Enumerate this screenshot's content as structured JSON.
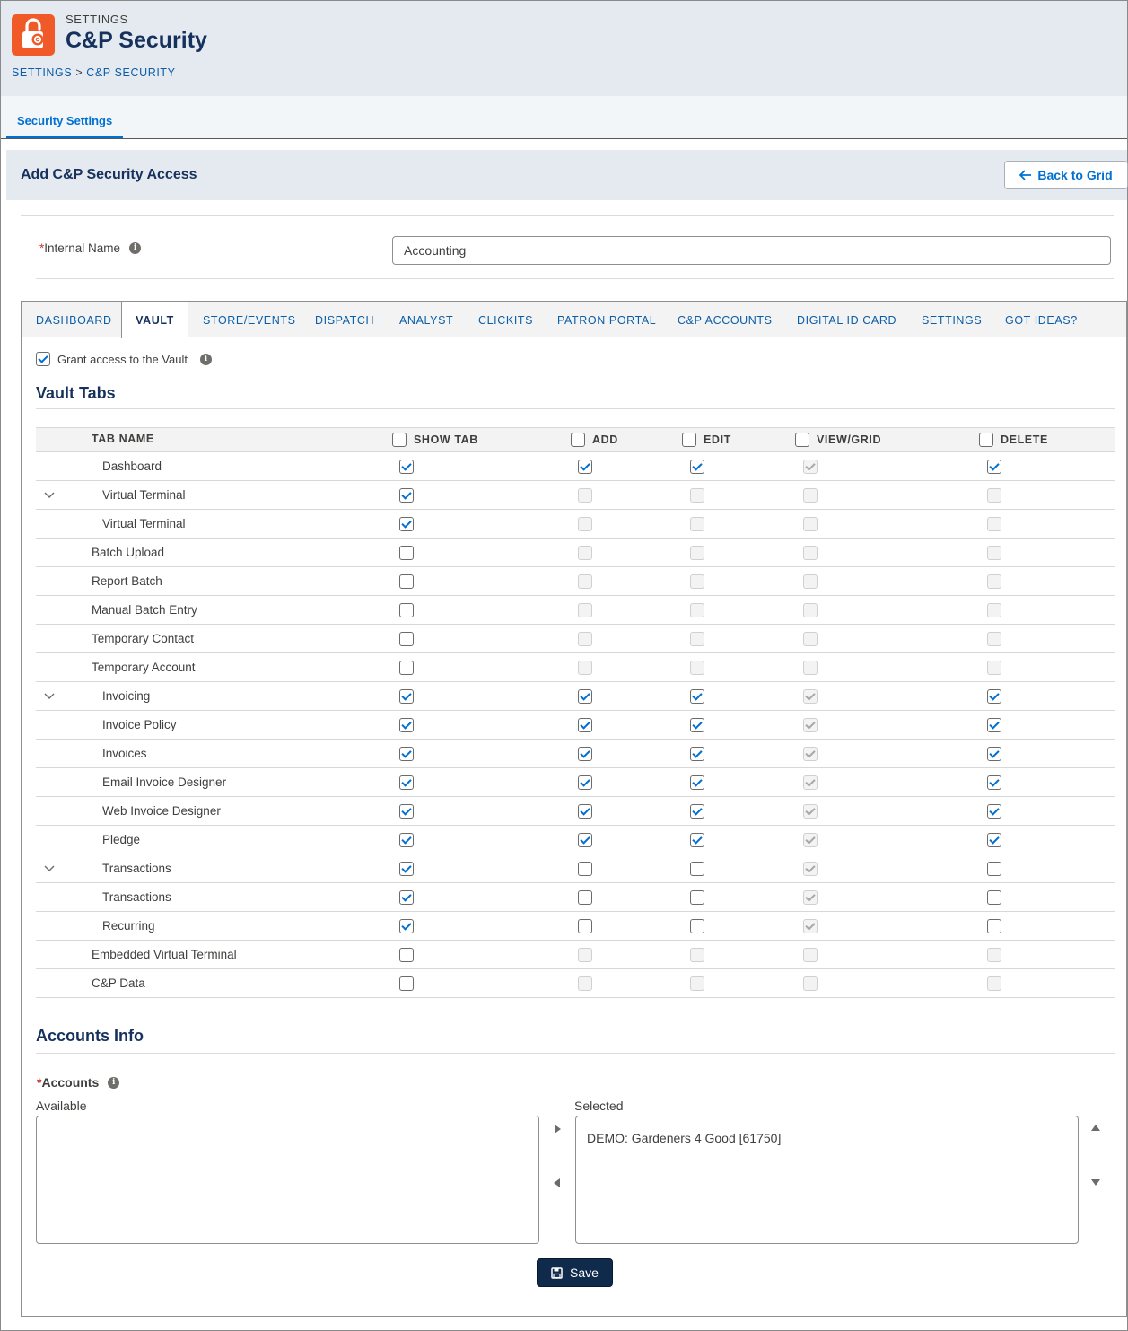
{
  "header": {
    "eyebrow": "SETTINGS",
    "title": "C&P Security",
    "breadcrumb": [
      "SETTINGS",
      ">",
      "C&P SECURITY"
    ]
  },
  "top_tabs": [
    {
      "label": "Security Settings",
      "active": true
    }
  ],
  "section": {
    "title": "Add C&P Security Access",
    "back_button": "Back to Grid"
  },
  "form": {
    "internal_name_label": "Internal Name",
    "internal_name_value": "Accounting"
  },
  "module_tabs": [
    "DASHBOARD",
    "VAULT",
    "STORE/EVENTS",
    "DISPATCH",
    "ANALYST",
    "CLICKITS",
    "PATRON PORTAL",
    "C&P ACCOUNTS",
    "DIGITAL ID CARD",
    "SETTINGS",
    "GOT IDEAS?"
  ],
  "active_module_tab": "VAULT",
  "vault": {
    "grant_label": "Grant access to the Vault",
    "grant_checked": true,
    "tabs_title": "Vault Tabs",
    "columns": [
      "TAB NAME",
      "SHOW TAB",
      "ADD",
      "EDIT",
      "VIEW/GRID",
      "DELETE"
    ],
    "rows": [
      {
        "name": "Dashboard",
        "indent": 1,
        "expander": false,
        "perms": [
          1,
          1,
          1,
          3,
          1
        ]
      },
      {
        "name": "Virtual Terminal",
        "indent": 1,
        "expander": true,
        "perms": [
          1,
          2,
          2,
          2,
          2
        ]
      },
      {
        "name": "Virtual Terminal",
        "indent": 1,
        "expander": false,
        "perms": [
          1,
          2,
          2,
          2,
          2
        ]
      },
      {
        "name": "Batch Upload",
        "indent": 0,
        "expander": false,
        "perms": [
          0,
          2,
          2,
          2,
          2
        ]
      },
      {
        "name": "Report Batch",
        "indent": 0,
        "expander": false,
        "perms": [
          0,
          2,
          2,
          2,
          2
        ]
      },
      {
        "name": "Manual Batch Entry",
        "indent": 0,
        "expander": false,
        "perms": [
          0,
          2,
          2,
          2,
          2
        ]
      },
      {
        "name": "Temporary Contact",
        "indent": 0,
        "expander": false,
        "perms": [
          0,
          2,
          2,
          2,
          2
        ]
      },
      {
        "name": "Temporary Account",
        "indent": 0,
        "expander": false,
        "perms": [
          0,
          2,
          2,
          2,
          2
        ]
      },
      {
        "name": "Invoicing",
        "indent": 1,
        "expander": true,
        "perms": [
          1,
          1,
          1,
          3,
          1
        ]
      },
      {
        "name": "Invoice Policy",
        "indent": 1,
        "expander": false,
        "perms": [
          1,
          1,
          1,
          3,
          1
        ]
      },
      {
        "name": "Invoices",
        "indent": 1,
        "expander": false,
        "perms": [
          1,
          1,
          1,
          3,
          1
        ]
      },
      {
        "name": "Email Invoice Designer",
        "indent": 1,
        "expander": false,
        "perms": [
          1,
          1,
          1,
          3,
          1
        ]
      },
      {
        "name": "Web Invoice Designer",
        "indent": 1,
        "expander": false,
        "perms": [
          1,
          1,
          1,
          3,
          1
        ]
      },
      {
        "name": "Pledge",
        "indent": 1,
        "expander": false,
        "perms": [
          1,
          1,
          1,
          3,
          1
        ]
      },
      {
        "name": "Transactions",
        "indent": 1,
        "expander": true,
        "perms": [
          1,
          0,
          0,
          3,
          0
        ]
      },
      {
        "name": "Transactions",
        "indent": 1,
        "expander": false,
        "perms": [
          1,
          0,
          0,
          3,
          0
        ]
      },
      {
        "name": "Recurring",
        "indent": 1,
        "expander": false,
        "perms": [
          1,
          0,
          0,
          3,
          0
        ]
      },
      {
        "name": "Embedded Virtual Terminal",
        "indent": 0,
        "expander": false,
        "perms": [
          0,
          2,
          2,
          2,
          2
        ]
      },
      {
        "name": "C&P Data",
        "indent": 0,
        "expander": false,
        "perms": [
          0,
          2,
          2,
          2,
          2
        ]
      }
    ]
  },
  "accounts": {
    "title": "Accounts Info",
    "label": "Accounts",
    "available_label": "Available",
    "selected_label": "Selected",
    "available": [],
    "selected": [
      "DEMO: Gardeners 4 Good [61750]"
    ]
  },
  "save_label": "Save",
  "colors": {
    "brand_orange": "#f05a28",
    "link_blue": "#0070d2",
    "navy": "#16325c",
    "save_button": "#0f2a4a"
  }
}
